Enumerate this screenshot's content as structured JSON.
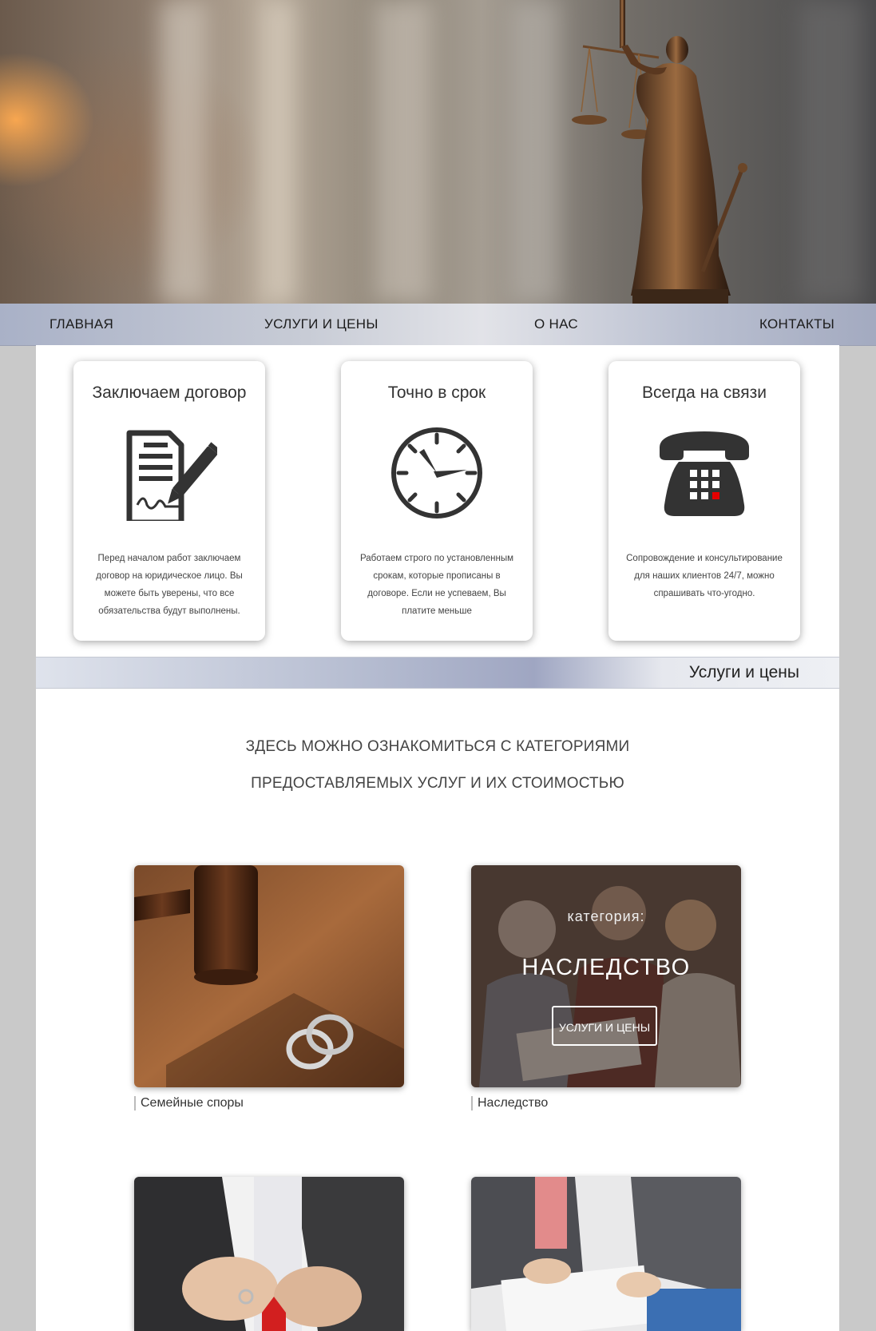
{
  "nav": {
    "items": [
      "ГЛАВНАЯ",
      "УСЛУГИ И ЦЕНЫ",
      "О НАС",
      "КОНТАКТЫ"
    ]
  },
  "features": [
    {
      "title": "Заключаем договор",
      "icon": "contract-icon",
      "text": "Перед началом работ заключаем договор на юридическое лицо. Вы можете быть уверены, что все обязательства будут выполнены."
    },
    {
      "title": "Точно в срок",
      "icon": "clock-icon",
      "text": "Работаем строго по установленным срокам, которые прописаны в договоре. Если не успеваем, Вы платите меньше"
    },
    {
      "title": "Всегда на связи",
      "icon": "telephone-icon",
      "text": "Сопровождение и консультирование для наших клиентов 24/7, можно спрашивать что-угодно."
    }
  ],
  "services": {
    "bar_title": "Услуги и цены",
    "intro_line1": "ЗДЕСЬ МОЖНО ОЗНАКОМИТЬСЯ С КАТЕГОРИЯМИ",
    "intro_line2": "ПРЕДОСТАВЛЯЕМЫХ УСЛУГ И ИХ СТОИМОСТЬЮ",
    "tiles": [
      {
        "caption": "Семейные споры"
      },
      {
        "caption": "Наследство",
        "overlay_small": "категория:",
        "overlay_title": "НАСЛЕДСТВО",
        "overlay_button": "УСЛУГИ И ЦЕНЫ"
      }
    ]
  },
  "colors": {
    "accent": "#e60000",
    "icon": "#333333"
  }
}
